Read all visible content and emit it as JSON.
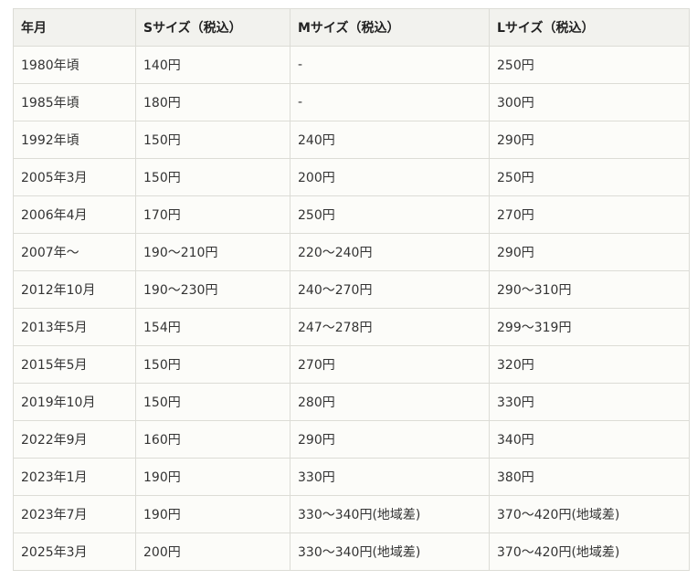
{
  "table": {
    "headers": [
      "年月",
      "Sサイズ（税込）",
      "Mサイズ（税込）",
      "Lサイズ（税込）"
    ],
    "rows": [
      [
        "1980年頃",
        "140円",
        "-",
        "250円"
      ],
      [
        "1985年頃",
        "180円",
        "-",
        "300円"
      ],
      [
        "1992年頃",
        "150円",
        "240円",
        "290円"
      ],
      [
        "2005年3月",
        "150円",
        "200円",
        "250円"
      ],
      [
        "2006年4月",
        "170円",
        "250円",
        "270円"
      ],
      [
        "2007年～",
        "190～210円",
        "220～240円",
        "290円"
      ],
      [
        "2012年10月",
        "190～230円",
        "240～270円",
        "290～310円"
      ],
      [
        "2013年5月",
        "154円",
        "247～278円",
        "299～319円"
      ],
      [
        "2015年5月",
        "150円",
        "270円",
        "320円"
      ],
      [
        "2019年10月",
        "150円",
        "280円",
        "330円"
      ],
      [
        "2022年9月",
        "160円",
        "290円",
        "340円"
      ],
      [
        "2023年1月",
        "190円",
        "330円",
        "380円"
      ],
      [
        "2023年7月",
        "190円",
        "330～340円(地域差)",
        "370～420円(地域差)"
      ],
      [
        "2025年3月",
        "200円",
        "330～340円(地域差)",
        "370～420円(地域差)"
      ]
    ]
  }
}
